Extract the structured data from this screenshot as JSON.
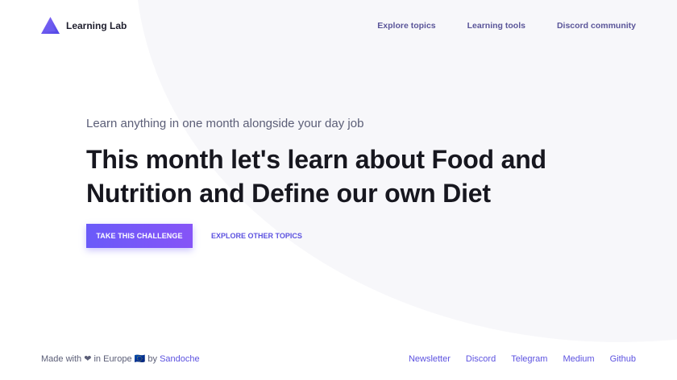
{
  "brand": {
    "name": "Learning Lab",
    "logo_icon": "triangle-logo-icon",
    "accent_color": "#6a5af9"
  },
  "nav": {
    "items": [
      {
        "label": "Explore topics"
      },
      {
        "label": "Learning tools"
      },
      {
        "label": "Discord community"
      }
    ]
  },
  "hero": {
    "tagline": "Learn anything in one month alongside your day job",
    "headline": "This month let's learn about Food and Nutrition and Define our own Diet",
    "primary_button": "TAKE THIS CHALLENGE",
    "secondary_button": "EXPLORE OTHER TOPICS"
  },
  "footer": {
    "made_with_prefix": "Made with",
    "heart": "❤",
    "in_location": "in Europe",
    "flag": "🇪🇺",
    "by": "by",
    "author": "Sandoche",
    "links": [
      {
        "label": "Newsletter"
      },
      {
        "label": "Discord"
      },
      {
        "label": "Telegram"
      },
      {
        "label": "Medium"
      },
      {
        "label": "Github"
      }
    ]
  }
}
